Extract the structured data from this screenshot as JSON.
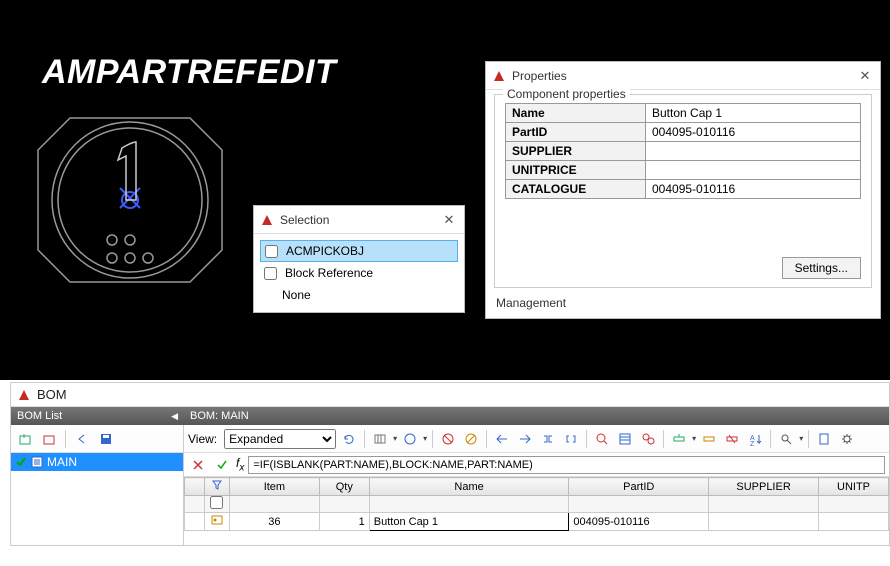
{
  "cad": {
    "title": "AMPARTREFEDIT"
  },
  "selection_dialog": {
    "title": "Selection",
    "items": [
      {
        "label": "ACMPICKOBJ",
        "checked": false,
        "selected": true
      },
      {
        "label": "Block Reference",
        "checked": false,
        "selected": false
      },
      {
        "label": "None",
        "checked": null,
        "selected": false
      }
    ]
  },
  "properties_dialog": {
    "title": "Properties",
    "group_label": "Component properties",
    "rows": [
      {
        "key": "Name",
        "value": "Button Cap 1"
      },
      {
        "key": "PartID",
        "value": "004095-010116"
      },
      {
        "key": "SUPPLIER",
        "value": ""
      },
      {
        "key": "UNITPRICE",
        "value": ""
      },
      {
        "key": "CATALOGUE",
        "value": "004095-010116"
      }
    ],
    "settings_label": "Settings...",
    "management_label": "Management"
  },
  "bom": {
    "title": "BOM",
    "list_header": "BOM List",
    "main_header": "BOM: MAIN",
    "tree_item": "MAIN",
    "view_label": "View:",
    "view_value": "Expanded",
    "formula": "=IF(ISBLANK(PART:NAME),BLOCK:NAME,PART:NAME)",
    "columns": [
      "",
      "",
      "Item",
      "Qty",
      "Name",
      "PartID",
      "SUPPLIER",
      "UNITP"
    ],
    "row": {
      "item": "36",
      "qty": "1",
      "name": "Button Cap 1",
      "partid": "004095-010116",
      "supplier": "",
      "unitp": ""
    }
  }
}
